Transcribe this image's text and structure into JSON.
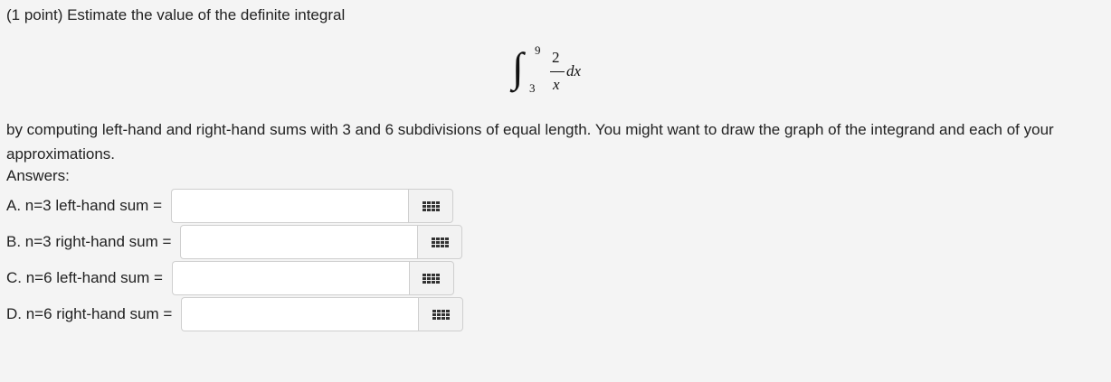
{
  "question": {
    "intro": "(1 point) Estimate the value of the definite integral",
    "integral": {
      "symbol": "∫",
      "upper_limit": "9",
      "lower_limit": "3",
      "numerator": "2",
      "denominator": "x",
      "differential": "dx"
    },
    "instructions": "by computing left-hand and right-hand sums with 3 and 6 subdivisions of equal length. You might want to draw the graph of the integrand and each of your approximations.",
    "answers_label": "Answers:"
  },
  "answers": [
    {
      "label": "A. n=3 left-hand sum =",
      "value": ""
    },
    {
      "label": "B. n=3 right-hand sum =",
      "value": ""
    },
    {
      "label": "C. n=6 left-hand sum =",
      "value": ""
    },
    {
      "label": "D. n=6 right-hand sum =",
      "value": ""
    }
  ],
  "icons": {
    "palette": "grid-keypad-icon"
  }
}
